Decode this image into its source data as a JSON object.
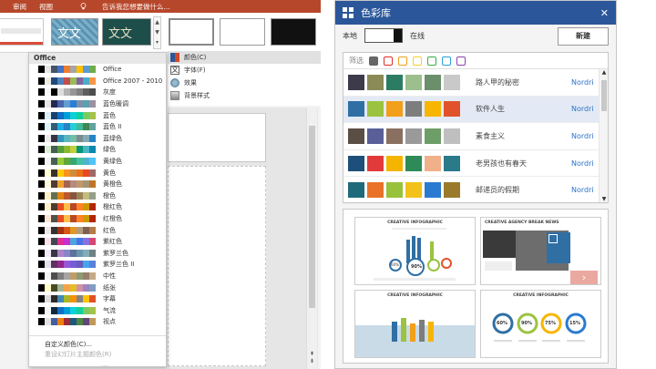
{
  "ribbon": {
    "tab_review": "审阅",
    "tab_view": "视图",
    "tell_me": "告诉我您想要做什么...",
    "thumb_text": "文文"
  },
  "colors_dropdown": {
    "header": "Office",
    "schemes": [
      {
        "name": "Office",
        "swatches": [
          "#ffffff",
          "#000000",
          "#e7e6e6",
          "#44546a",
          "#4472c4",
          "#ed7d31",
          "#a5a5a5",
          "#ffc000",
          "#5b9bd5",
          "#70ad47"
        ]
      },
      {
        "name": "Office 2007 - 2010",
        "swatches": [
          "#ffffff",
          "#000000",
          "#eeece1",
          "#1f497d",
          "#4f81bd",
          "#c0504d",
          "#9bbb59",
          "#8064a2",
          "#4bacc6",
          "#f79646"
        ]
      },
      {
        "name": "灰度",
        "swatches": [
          "#ffffff",
          "#000000",
          "#f8f8f8",
          "#000000",
          "#dddddd",
          "#b2b2b2",
          "#969696",
          "#808080",
          "#5f5f5f",
          "#4d4d4d"
        ]
      },
      {
        "name": "蓝色暖调",
        "swatches": [
          "#ffffff",
          "#000000",
          "#e7e6e6",
          "#242852",
          "#4a66ac",
          "#629dd1",
          "#297fd5",
          "#7f8fa9",
          "#5aa2ae",
          "#9d90a0"
        ]
      },
      {
        "name": "蓝色",
        "swatches": [
          "#ffffff",
          "#000000",
          "#dbeff9",
          "#17406d",
          "#0f6fc6",
          "#009dd9",
          "#0bd0d9",
          "#10cf9b",
          "#7cca62",
          "#a5c249"
        ]
      },
      {
        "name": "蓝色 II",
        "swatches": [
          "#ffffff",
          "#000000",
          "#dbf5f9",
          "#335b74",
          "#1cade4",
          "#2683c6",
          "#27ced7",
          "#42ba97",
          "#3e8853",
          "#62a39f"
        ]
      },
      {
        "name": "蓝绿色",
        "swatches": [
          "#ffffff",
          "#000000",
          "#ebebeb",
          "#373545",
          "#3494ba",
          "#58b6c0",
          "#75bda7",
          "#7a8c8e",
          "#84acb6",
          "#2683c6"
        ]
      },
      {
        "name": "绿色",
        "swatches": [
          "#ffffff",
          "#000000",
          "#dbefd5",
          "#455f51",
          "#549e39",
          "#8ab833",
          "#c0cf3a",
          "#029676",
          "#4ab5c4",
          "#0989b1"
        ]
      },
      {
        "name": "黄绿色",
        "swatches": [
          "#ffffff",
          "#000000",
          "#f2f2f2",
          "#455f51",
          "#99cb38",
          "#63a537",
          "#37a76f",
          "#44c1a3",
          "#4eb3cf",
          "#51c3f9"
        ]
      },
      {
        "name": "黄色",
        "swatches": [
          "#ffffff",
          "#000000",
          "#fffcd5",
          "#39302a",
          "#ffca08",
          "#f8931d",
          "#ce8d3e",
          "#ec7016",
          "#e64823",
          "#9c6a6a"
        ]
      },
      {
        "name": "黄橙色",
        "swatches": [
          "#ffffff",
          "#000000",
          "#fff7d9",
          "#4e3b30",
          "#f0a22e",
          "#a5644e",
          "#b58b80",
          "#c3986d",
          "#a19574",
          "#c17529"
        ]
      },
      {
        "name": "橙色",
        "swatches": [
          "#ffffff",
          "#000000",
          "#fbeec9",
          "#637052",
          "#e48312",
          "#bd582c",
          "#865640",
          "#9b8357",
          "#c2bc80",
          "#94a088"
        ]
      },
      {
        "name": "橙红色",
        "swatches": [
          "#ffffff",
          "#000000",
          "#fbeec9",
          "#4e3b30",
          "#e84c22",
          "#ffbd47",
          "#b64926",
          "#ff8427",
          "#cc9900",
          "#b22600"
        ]
      },
      {
        "name": "红橙色",
        "swatches": [
          "#ffffff",
          "#000000",
          "#fce5d4",
          "#505046",
          "#e84c22",
          "#ffbd47",
          "#b64926",
          "#ff8427",
          "#cc9900",
          "#b22600"
        ]
      },
      {
        "name": "红色",
        "swatches": [
          "#ffffff",
          "#000000",
          "#f0e6e6",
          "#323232",
          "#a5300f",
          "#d55816",
          "#e19825",
          "#b19c7d",
          "#7f5f52",
          "#b27d49"
        ]
      },
      {
        "name": "紫红色",
        "swatches": [
          "#ffffff",
          "#000000",
          "#fae1ea",
          "#454551",
          "#e32d91",
          "#c830cc",
          "#4ea6dc",
          "#4775e7",
          "#8971e1",
          "#d54773"
        ]
      },
      {
        "name": "紫罗兰色",
        "swatches": [
          "#ffffff",
          "#000000",
          "#f2e7f7",
          "#373545",
          "#ad84c6",
          "#8784c7",
          "#5d739a",
          "#6997af",
          "#84acb6",
          "#6f8183"
        ]
      },
      {
        "name": "紫罗兰色 II",
        "swatches": [
          "#ffffff",
          "#000000",
          "#e6e0ec",
          "#632e62",
          "#92278f",
          "#9b57d3",
          "#755dd9",
          "#665eb8",
          "#45a5ed",
          "#5982db"
        ]
      },
      {
        "name": "中性",
        "swatches": [
          "#ffffff",
          "#000000",
          "#f2f2f2",
          "#4d4d4d",
          "#7f7f7f",
          "#a5a5a5",
          "#c09d68",
          "#8d9a73",
          "#967f6b",
          "#c6aa87"
        ]
      },
      {
        "name": "纸张",
        "swatches": [
          "#ffffff",
          "#000000",
          "#fefac9",
          "#444d26",
          "#a5b592",
          "#f3a447",
          "#e7bc29",
          "#d092a7",
          "#9c85c0",
          "#809ec2"
        ]
      },
      {
        "name": "字幕",
        "swatches": [
          "#ffffff",
          "#000000",
          "#dcdcdc",
          "#2b2b2b",
          "#418ab3",
          "#a6b727",
          "#f69200",
          "#838383",
          "#fec306",
          "#df5327"
        ]
      },
      {
        "name": "气流",
        "swatches": [
          "#ffffff",
          "#000000",
          "#f0f6f8",
          "#0f2a3f",
          "#0f6fc6",
          "#009dd9",
          "#0bd0d9",
          "#10cf9b",
          "#7cca62",
          "#a5c249"
        ]
      },
      {
        "name": "视点",
        "swatches": [
          "#ffffff",
          "#000000",
          "#e3e3e3",
          "#465e9c",
          "#f07f09",
          "#9f2936",
          "#1b587c",
          "#4e8542",
          "#604878",
          "#c19859"
        ]
      }
    ],
    "customize": "自定义颜色(C)...",
    "reset": "重设幻灯片主题颜色(R)"
  },
  "variant_menu": {
    "items": [
      "颜色(C)",
      "字体(F)",
      "效果",
      "背景样式"
    ]
  },
  "panel": {
    "title": "色彩库",
    "local": "本地",
    "online": "在线",
    "new_button": "新建",
    "filter_label": "筛选",
    "filter_colors": [
      "#666666",
      "#e0302b",
      "#f0a020",
      "#f2d22a",
      "#35b04a",
      "#2aa0d8",
      "#8a44b0"
    ],
    "schemes": [
      {
        "name": "路人甲的秘密",
        "author": "Nordri",
        "cells": [
          "#3d3a4b",
          "#8a8b57",
          "#2b7c62",
          "#9cbf8d",
          "#6b8f6b",
          "#c9c9c9"
        ]
      },
      {
        "name": "软件人生",
        "author": "Nordri",
        "cells": [
          "#2f6fa4",
          "#9bc33f",
          "#f29f1b",
          "#7d7d7d",
          "#f7b500",
          "#e2522a"
        ]
      },
      {
        "name": "素食主义",
        "author": "Nordri",
        "cells": [
          "#5a4e45",
          "#5a5f98",
          "#8a7060",
          "#9a9a9a",
          "#6e9e68",
          "#bfbfbf"
        ]
      },
      {
        "name": "老男孩也有春天",
        "author": "Nordri",
        "cells": [
          "#1d4f7a",
          "#e23a3a",
          "#f4b400",
          "#2e8b57",
          "#f0b08a",
          "#2a7a8a"
        ]
      },
      {
        "name": "邮递员的假期",
        "author": "Nordri",
        "cells": [
          "#1e6a7a",
          "#e8722a",
          "#98c23c",
          "#f2c21a",
          "#2a7ad2",
          "#9a7a2a"
        ]
      }
    ],
    "preview_titles": [
      "CREATIVE INFOGRAPHIC",
      "CREATIVE AGENCY BREAK NEWS",
      "CREATIVE INFOGRAPHIC",
      "CREATIVE INFOGRAPHIC"
    ],
    "percents": [
      "60%",
      "90%",
      "75%",
      "15%"
    ]
  }
}
